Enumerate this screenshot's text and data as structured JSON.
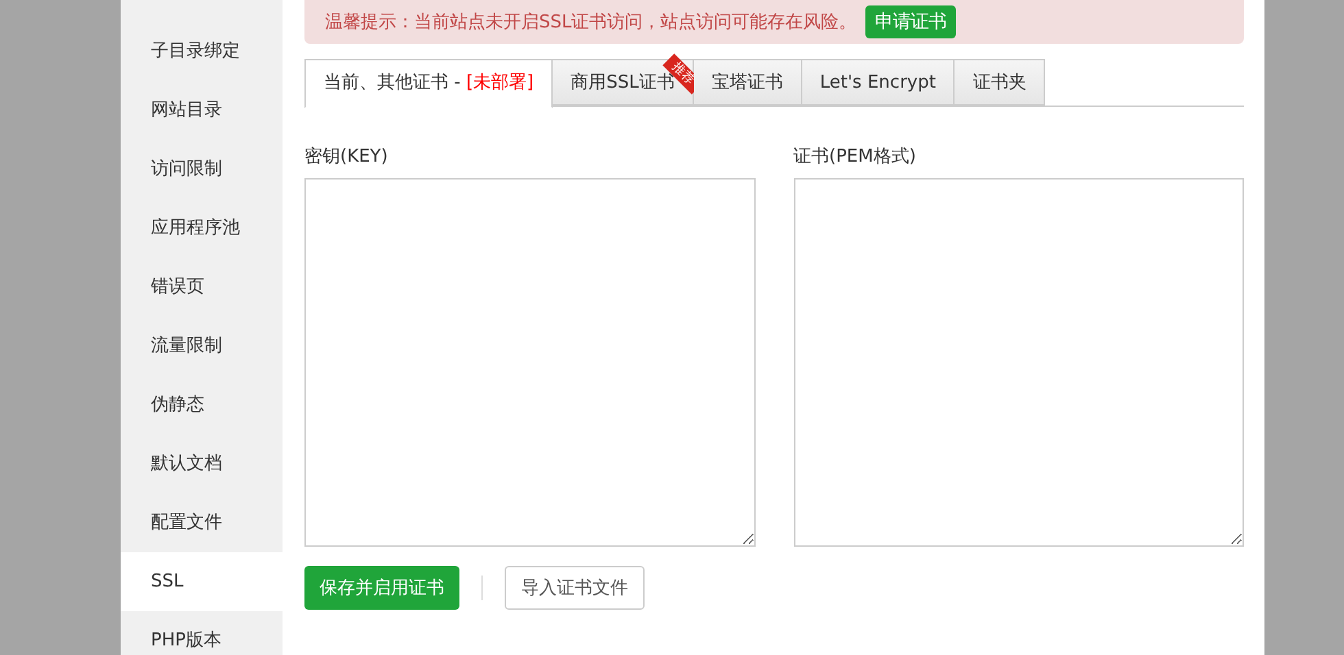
{
  "sidebar": {
    "items": [
      {
        "label": "子目录绑定",
        "selected": false
      },
      {
        "label": "网站目录",
        "selected": false
      },
      {
        "label": "访问限制",
        "selected": false
      },
      {
        "label": "应用程序池",
        "selected": false
      },
      {
        "label": "错误页",
        "selected": false
      },
      {
        "label": "流量限制",
        "selected": false
      },
      {
        "label": "伪静态",
        "selected": false
      },
      {
        "label": "默认文档",
        "selected": false
      },
      {
        "label": "配置文件",
        "selected": false
      },
      {
        "label": "SSL",
        "selected": true
      },
      {
        "label": "PHP版本",
        "selected": false
      }
    ]
  },
  "alert": {
    "text": "温馨提示：当前站点未开启SSL证书访问，站点访问可能存在风险。",
    "button": "申请证书"
  },
  "tabs": [
    {
      "label": "当前、其他证书 - ",
      "status": "[未部署]",
      "selected": true
    },
    {
      "label": "商用SSL证书",
      "ribbon": "推荐",
      "selected": false
    },
    {
      "label": "宝塔证书",
      "selected": false
    },
    {
      "label": "Let's Encrypt",
      "selected": false
    },
    {
      "label": "证书夹",
      "selected": false
    }
  ],
  "fields": [
    {
      "label": "密钥(KEY)"
    },
    {
      "label": "证书(PEM格式)"
    }
  ],
  "buttons": [
    {
      "label": "保存并启用证书",
      "kind": "primary"
    },
    {
      "label": "导入证书文件",
      "kind": "default"
    }
  ]
}
